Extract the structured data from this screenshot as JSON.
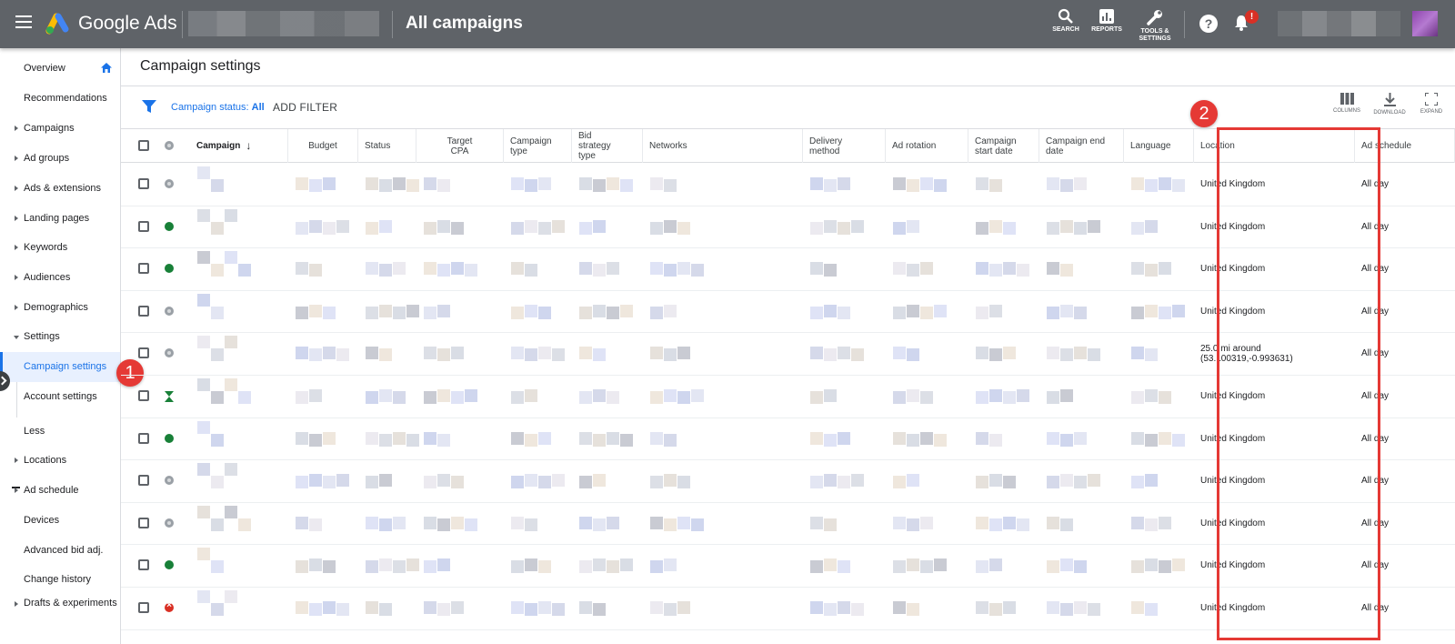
{
  "topbar": {
    "brand": "Google Ads",
    "page_title": "All campaigns",
    "tools": [
      {
        "label": "SEARCH",
        "icon": "search-icon"
      },
      {
        "label": "REPORTS",
        "icon": "reports-icon"
      },
      {
        "label": "TOOLS & SETTINGS",
        "icon": "wrench-icon"
      }
    ],
    "help": "?",
    "notification_badge": "!"
  },
  "sidebar": {
    "items": [
      {
        "label": "Overview",
        "caret": "none"
      },
      {
        "label": "Recommendations",
        "caret": "none"
      },
      {
        "label": "Campaigns",
        "caret": "right"
      },
      {
        "label": "Ad groups",
        "caret": "right"
      },
      {
        "label": "Ads & extensions",
        "caret": "right"
      },
      {
        "label": "Landing pages",
        "caret": "right"
      },
      {
        "label": "Keywords",
        "caret": "right"
      },
      {
        "label": "Audiences",
        "caret": "right"
      },
      {
        "label": "Demographics",
        "caret": "right"
      },
      {
        "label": "Settings",
        "caret": "down"
      },
      {
        "label": "Campaign settings",
        "caret": "none",
        "active": true
      },
      {
        "label": "Account settings",
        "caret": "none"
      },
      {
        "label": "Less",
        "caret": "none"
      },
      {
        "label": "Locations",
        "caret": "right"
      },
      {
        "label": "Ad schedule",
        "caret": "right"
      },
      {
        "label": "Devices",
        "caret": "none"
      },
      {
        "label": "Advanced bid adj.",
        "caret": "none"
      },
      {
        "label": "Change history",
        "caret": "none"
      },
      {
        "label": "Drafts & experiments",
        "caret": "right"
      }
    ]
  },
  "annotations": {
    "badge_1": "1",
    "badge_2": "2"
  },
  "main": {
    "title": "Campaign settings",
    "filter": {
      "label": "Campaign status: ",
      "value": "All",
      "add_filter": "ADD FILTER"
    },
    "toolbar": [
      {
        "label": "COLUMNS",
        "icon": "columns-icon"
      },
      {
        "label": "DOWNLOAD",
        "icon": "download-icon"
      },
      {
        "label": "EXPAND",
        "icon": "expand-icon"
      }
    ]
  },
  "table": {
    "columns": [
      {
        "label": "Campaign",
        "sort": "desc"
      },
      {
        "label": "Budget"
      },
      {
        "label": "Status"
      },
      {
        "label": "Target CPA"
      },
      {
        "label": "Campaign type"
      },
      {
        "label": "Bid strategy type"
      },
      {
        "label": "Networks"
      },
      {
        "label": "Delivery method"
      },
      {
        "label": "Ad rotation"
      },
      {
        "label": "Campaign start date"
      },
      {
        "label": "Campaign end date"
      },
      {
        "label": "Language"
      },
      {
        "label": "Location"
      },
      {
        "label": "Ad schedule"
      }
    ],
    "rows": [
      {
        "status": "grey",
        "location": "United Kingdom",
        "ad_schedule": "All day"
      },
      {
        "status": "green",
        "location": "United Kingdom",
        "ad_schedule": "All day"
      },
      {
        "status": "green",
        "location": "United Kingdom",
        "ad_schedule": "All day"
      },
      {
        "status": "grey",
        "location": "United Kingdom",
        "ad_schedule": "All day"
      },
      {
        "status": "grey",
        "location": "25.0 mi around (53.100319,-0.993631)",
        "ad_schedule": "All day"
      },
      {
        "status": "hourglass",
        "location": "United Kingdom",
        "ad_schedule": "All day"
      },
      {
        "status": "green",
        "location": "United Kingdom",
        "ad_schedule": "All day"
      },
      {
        "status": "grey",
        "location": "United Kingdom",
        "ad_schedule": "All day"
      },
      {
        "status": "grey",
        "location": "United Kingdom",
        "ad_schedule": "All day"
      },
      {
        "status": "green",
        "location": "United Kingdom",
        "ad_schedule": "All day"
      },
      {
        "status": "red",
        "location": "United Kingdom",
        "ad_schedule": "All day"
      }
    ]
  },
  "colors": {
    "accent": "#1a73e8",
    "topbar": "#5f6368",
    "highlight": "#e53935"
  }
}
